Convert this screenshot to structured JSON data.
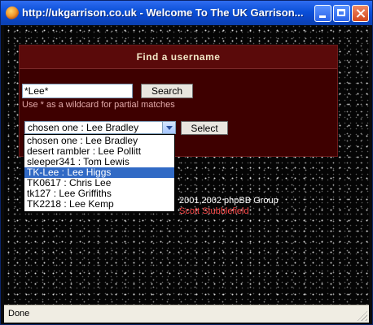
{
  "window": {
    "title": "http://ukgarrison.co.uk - Welcome To The UK Garrison..."
  },
  "panel": {
    "heading": "Find a username"
  },
  "search": {
    "value": "*Lee*",
    "button_label": "Search",
    "hint": "Use * as a wildcard for partial matches"
  },
  "select": {
    "current_value": "chosen one : Lee Bradley",
    "button_label": "Select",
    "options": [
      "chosen one : Lee Bradley",
      "desert rambler : Lee Pollitt",
      "sleeper341 : Tom Lewis",
      "TK-Lee : Lee Higgs",
      "TK0617 : Chris Lee",
      "tk127 : Lee Griffiths",
      "TK2218 : Lee Kemp"
    ],
    "highlighted_index": 3
  },
  "footer": {
    "text": "2001,2002 phpBB Group",
    "link": "Scott Stubblefield"
  },
  "status": {
    "text": "Done"
  },
  "icons": {
    "app": "firefox-icon",
    "minimize": "minimize-icon",
    "maximize": "maximize-icon",
    "close": "close-icon"
  },
  "colors": {
    "titlebar": "#0a4fd8",
    "panel": "#3e0000",
    "selection": "#316ac5",
    "link": "#ff4a4a"
  }
}
